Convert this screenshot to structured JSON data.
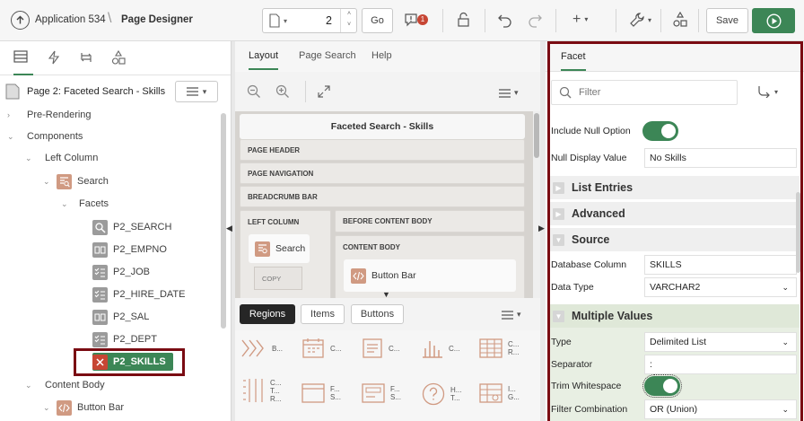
{
  "header": {
    "app_name": "Application 534",
    "page_designer": "Page Designer",
    "page_number": "2",
    "go_label": "Go",
    "warnings_count": "1",
    "save_label": "Save"
  },
  "left_panel": {
    "page_title": "Page 2: Faceted Search - Skills",
    "tree": [
      {
        "label": "Pre-Rendering",
        "level": 0
      },
      {
        "label": "Components",
        "level": 0
      },
      {
        "label": "Left Column",
        "level": 1
      },
      {
        "label": "Search",
        "level": 2
      },
      {
        "label": "Facets",
        "level": 3
      },
      {
        "label": "P2_SEARCH",
        "level": 4
      },
      {
        "label": "P2_EMPNO",
        "level": 4
      },
      {
        "label": "P2_JOB",
        "level": 4
      },
      {
        "label": "P2_HIRE_DATE",
        "level": 4
      },
      {
        "label": "P2_SAL",
        "level": 4
      },
      {
        "label": "P2_DEPT",
        "level": 4
      },
      {
        "label": "P2_SKILLS",
        "level": 4
      },
      {
        "label": "Content Body",
        "level": 1
      },
      {
        "label": "Button Bar",
        "level": 2
      }
    ]
  },
  "center": {
    "tabs": [
      "Layout",
      "Page Search",
      "Help"
    ],
    "canvas_title": "Faceted Search - Skills",
    "regions": {
      "page_header": "PAGE HEADER",
      "page_navigation": "PAGE NAVIGATION",
      "breadcrumb_bar": "BREADCRUMB BAR",
      "left_column": "LEFT COLUMN",
      "before_content_body": "BEFORE CONTENT BODY",
      "content_body": "CONTENT BODY",
      "search": "Search",
      "copy": "COPY",
      "button_bar": "Button Bar"
    },
    "gallery_tabs": [
      "Regions",
      "Items",
      "Buttons"
    ],
    "gallery_items": [
      {
        "icon": "chevron-steps-icon",
        "label": "B..."
      },
      {
        "icon": "calendar-icon",
        "label": "C..."
      },
      {
        "icon": "document-icon",
        "label": "C..."
      },
      {
        "icon": "bar-chart-icon",
        "label": "C..."
      },
      {
        "icon": "table-grid-icon",
        "label": "C... R..."
      },
      {
        "icon": "checklist-icon",
        "label": "C... T... R..."
      },
      {
        "icon": "window-icon",
        "label": "F... S..."
      },
      {
        "icon": "form-icon",
        "label": "F... S..."
      },
      {
        "icon": "help-icon",
        "label": "H... T..."
      },
      {
        "icon": "interactive-grid-icon",
        "label": "I... G..."
      }
    ]
  },
  "right_panel": {
    "tab": "Facet",
    "filter_placeholder": "Filter",
    "include_null_label": "Include Null Option",
    "null_display_label": "Null Display Value",
    "null_display_value": "No Skills",
    "sections": {
      "list_entries": "List Entries",
      "advanced": "Advanced",
      "source": "Source",
      "multiple_values": "Multiple Values"
    },
    "database_column_label": "Database Column",
    "database_column_value": "SKILLS",
    "data_type_label": "Data Type",
    "data_type_value": "VARCHAR2",
    "type_label": "Type",
    "type_value": "Delimited List",
    "separator_label": "Separator",
    "separator_value": ":",
    "trim_whitespace_label": "Trim Whitespace",
    "filter_combination_label": "Filter Combination",
    "filter_combination_value": "OR (Union)"
  },
  "colors": {
    "accent_green": "#3c8656",
    "highlight_frame": "#7a0b12",
    "badge_red": "#c74634",
    "component_icon": "#d09a82"
  }
}
